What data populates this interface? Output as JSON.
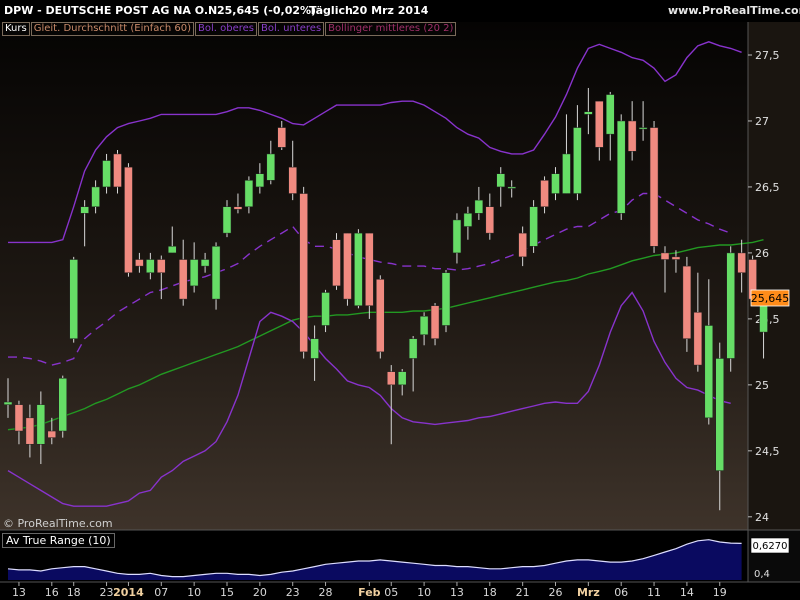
{
  "header": {
    "symbol_line": "DPW - DEUTSCHE POST AG NA O.N.",
    "price_change": "25,645 (-0,02%)",
    "period": "Täglich",
    "date": "20 Mrz 2014",
    "site": "www.ProRealTime.com"
  },
  "legend": {
    "items": [
      {
        "label": "Kurs",
        "color": "#ffffff"
      },
      {
        "label": "Gleit. Durchschnitt (Einfach 60)",
        "color": "#c98a6a"
      },
      {
        "label": "Bol. oberes",
        "color": "#8a3fc8"
      },
      {
        "label": "Bol. unteres",
        "color": "#8a3fc8"
      },
      {
        "label": "Bollinger mittleres (20 2)",
        "color": "#a0306a"
      }
    ]
  },
  "copyright": "© ProRealTime.com",
  "price_label": "25,645",
  "atr": {
    "title": "Av True Range (10)",
    "value_label": "0,6270",
    "tick_label": "0,4",
    "values": [
      0.4,
      0.39,
      0.39,
      0.38,
      0.4,
      0.41,
      0.42,
      0.42,
      0.4,
      0.38,
      0.36,
      0.35,
      0.35,
      0.36,
      0.34,
      0.33,
      0.33,
      0.34,
      0.35,
      0.36,
      0.36,
      0.35,
      0.35,
      0.34,
      0.35,
      0.37,
      0.38,
      0.4,
      0.42,
      0.44,
      0.45,
      0.46,
      0.47,
      0.47,
      0.48,
      0.47,
      0.46,
      0.45,
      0.44,
      0.43,
      0.43,
      0.42,
      0.42,
      0.41,
      0.4,
      0.4,
      0.41,
      0.42,
      0.42,
      0.43,
      0.45,
      0.47,
      0.48,
      0.48,
      0.47,
      0.46,
      0.46,
      0.47,
      0.49,
      0.52,
      0.55,
      0.58,
      0.62,
      0.65,
      0.66,
      0.64,
      0.63,
      0.627
    ],
    "ylim": [
      0.3,
      0.72
    ]
  },
  "colors": {
    "up": "#66dd66",
    "down": "#f08a80",
    "ma60": "#229922",
    "boll_band": "#8833cc",
    "boll_mid": "#8833cc",
    "atr_fill": "#0a0a60",
    "atr_line": "#ddddff"
  },
  "chart_data": {
    "type": "candlestick",
    "ylim": [
      23.9,
      27.75
    ],
    "yticks": [
      24,
      24.5,
      25,
      25.5,
      26,
      26.5,
      27,
      27.5
    ],
    "ytick_labels": [
      "24",
      "24,5",
      "25",
      "25,5",
      "26",
      "26,5",
      "27",
      "27,5"
    ],
    "xtick_labels": [
      {
        "i": 1,
        "label": "13"
      },
      {
        "i": 4,
        "label": "16"
      },
      {
        "i": 6,
        "label": "18"
      },
      {
        "i": 9,
        "label": "23"
      },
      {
        "i": 11,
        "label": "2014"
      },
      {
        "i": 14,
        "label": "07"
      },
      {
        "i": 17,
        "label": "10"
      },
      {
        "i": 20,
        "label": "15"
      },
      {
        "i": 23,
        "label": "20"
      },
      {
        "i": 26,
        "label": "23"
      },
      {
        "i": 29,
        "label": "28"
      },
      {
        "i": 33,
        "label": "Feb"
      },
      {
        "i": 35,
        "label": "05"
      },
      {
        "i": 38,
        "label": "10"
      },
      {
        "i": 41,
        "label": "13"
      },
      {
        "i": 44,
        "label": "18"
      },
      {
        "i": 47,
        "label": "21"
      },
      {
        "i": 50,
        "label": "26"
      },
      {
        "i": 53,
        "label": "Mrz"
      },
      {
        "i": 56,
        "label": "06"
      },
      {
        "i": 59,
        "label": "11"
      },
      {
        "i": 62,
        "label": "14"
      },
      {
        "i": 65,
        "label": "19"
      }
    ],
    "candles": [
      [
        24.85,
        24.87,
        24.75,
        25.05
      ],
      [
        24.85,
        24.65,
        24.55,
        24.88
      ],
      [
        24.75,
        24.55,
        24.45,
        24.85
      ],
      [
        24.55,
        24.85,
        24.4,
        24.95
      ],
      [
        24.65,
        24.6,
        24.55,
        24.75
      ],
      [
        24.65,
        25.05,
        24.6,
        25.07
      ],
      [
        25.35,
        25.95,
        25.32,
        25.97
      ],
      [
        26.3,
        26.35,
        26.05,
        26.4
      ],
      [
        26.35,
        26.5,
        26.3,
        26.55
      ],
      [
        26.5,
        26.7,
        26.45,
        26.75
      ],
      [
        26.75,
        26.5,
        26.45,
        26.78
      ],
      [
        26.65,
        25.85,
        25.82,
        26.68
      ],
      [
        25.95,
        25.9,
        25.85,
        26.0
      ],
      [
        25.85,
        25.95,
        25.8,
        26.0
      ],
      [
        25.95,
        25.85,
        25.65,
        25.98
      ],
      [
        26.0,
        26.05,
        26.0,
        26.2
      ],
      [
        25.95,
        25.65,
        25.6,
        26.1
      ],
      [
        25.75,
        25.95,
        25.7,
        26.08
      ],
      [
        25.9,
        25.95,
        25.85,
        26.0
      ],
      [
        25.65,
        26.05,
        25.57,
        26.08
      ],
      [
        26.15,
        26.35,
        26.12,
        26.4
      ],
      [
        26.35,
        26.33,
        26.3,
        26.45
      ],
      [
        26.35,
        26.55,
        26.3,
        26.58
      ],
      [
        26.5,
        26.6,
        26.45,
        26.68
      ],
      [
        26.55,
        26.75,
        26.52,
        26.85
      ],
      [
        26.95,
        26.8,
        26.78,
        27.0
      ],
      [
        26.65,
        26.45,
        26.4,
        26.85
      ],
      [
        26.45,
        25.25,
        25.2,
        26.5
      ],
      [
        25.2,
        25.35,
        25.03,
        25.45
      ],
      [
        25.45,
        25.7,
        25.4,
        25.72
      ],
      [
        26.1,
        25.75,
        25.72,
        26.15
      ],
      [
        26.15,
        25.65,
        25.6,
        26.15
      ],
      [
        25.6,
        26.15,
        25.58,
        26.18
      ],
      [
        26.15,
        25.6,
        25.5,
        26.15
      ],
      [
        25.8,
        25.25,
        25.2,
        25.83
      ],
      [
        25.1,
        25.0,
        24.55,
        25.15
      ],
      [
        25.0,
        25.1,
        24.92,
        25.12
      ],
      [
        25.2,
        25.35,
        24.95,
        25.37
      ],
      [
        25.38,
        25.52,
        25.3,
        25.55
      ],
      [
        25.6,
        25.35,
        25.3,
        25.62
      ],
      [
        25.45,
        25.85,
        25.4,
        25.87
      ],
      [
        26.0,
        26.25,
        25.92,
        26.3
      ],
      [
        26.2,
        26.3,
        26.1,
        26.35
      ],
      [
        26.3,
        26.4,
        26.25,
        26.5
      ],
      [
        26.35,
        26.15,
        26.1,
        26.45
      ],
      [
        26.5,
        26.6,
        26.35,
        26.65
      ],
      [
        26.5,
        26.5,
        26.42,
        26.55
      ],
      [
        26.15,
        25.97,
        25.9,
        26.2
      ],
      [
        26.05,
        26.35,
        26.0,
        26.4
      ],
      [
        26.55,
        26.35,
        26.3,
        26.58
      ],
      [
        26.45,
        26.6,
        26.4,
        26.65
      ],
      [
        26.45,
        26.75,
        26.45,
        27.05
      ],
      [
        26.45,
        26.95,
        26.4,
        27.12
      ],
      [
        27.05,
        27.07,
        26.9,
        27.25
      ],
      [
        27.15,
        26.8,
        26.7,
        27.15
      ],
      [
        26.9,
        27.2,
        26.7,
        27.22
      ],
      [
        26.3,
        27.0,
        26.25,
        27.05
      ],
      [
        27.0,
        26.77,
        26.7,
        27.15
      ],
      [
        26.95,
        26.95,
        26.85,
        27.15
      ],
      [
        26.95,
        26.05,
        26.0,
        27.0
      ],
      [
        26.0,
        25.95,
        25.7,
        26.05
      ],
      [
        25.97,
        25.95,
        25.85,
        26.02
      ],
      [
        25.9,
        25.35,
        25.25,
        25.97
      ],
      [
        25.55,
        25.15,
        25.1,
        25.85
      ],
      [
        24.75,
        25.45,
        24.7,
        25.8
      ],
      [
        24.35,
        25.2,
        24.05,
        25.32
      ],
      [
        25.2,
        26.0,
        25.1,
        26.05
      ],
      [
        26.0,
        25.85,
        25.7,
        26.1
      ],
      [
        25.95,
        25.65,
        25.6,
        25.98
      ],
      [
        25.4,
        25.65,
        25.2,
        25.7
      ]
    ],
    "ma60": [
      24.66,
      24.67,
      24.68,
      24.7,
      24.73,
      24.76,
      24.79,
      24.82,
      24.86,
      24.89,
      24.93,
      24.97,
      25.0,
      25.04,
      25.08,
      25.11,
      25.14,
      25.17,
      25.2,
      25.23,
      25.26,
      25.29,
      25.33,
      25.37,
      25.41,
      25.45,
      25.49,
      25.51,
      25.52,
      25.52,
      25.53,
      25.53,
      25.54,
      25.55,
      25.55,
      25.55,
      25.55,
      25.56,
      25.56,
      25.57,
      25.58,
      25.6,
      25.62,
      25.64,
      25.66,
      25.68,
      25.7,
      25.72,
      25.74,
      25.76,
      25.78,
      25.79,
      25.81,
      25.84,
      25.86,
      25.88,
      25.91,
      25.94,
      25.96,
      25.98,
      25.99,
      26.0,
      26.02,
      26.04,
      26.05,
      26.06,
      26.06,
      26.07,
      26.08,
      26.1
    ],
    "boll_upper": [
      26.08,
      26.08,
      26.08,
      26.08,
      26.08,
      26.1,
      26.35,
      26.62,
      26.78,
      26.88,
      26.95,
      26.98,
      27.0,
      27.02,
      27.05,
      27.05,
      27.05,
      27.05,
      27.05,
      27.05,
      27.07,
      27.1,
      27.1,
      27.08,
      27.05,
      27.02,
      26.98,
      26.97,
      27.02,
      27.07,
      27.12,
      27.12,
      27.12,
      27.12,
      27.12,
      27.14,
      27.15,
      27.15,
      27.12,
      27.07,
      27.02,
      26.95,
      26.9,
      26.87,
      26.8,
      26.77,
      26.75,
      26.75,
      26.78,
      26.9,
      27.03,
      27.2,
      27.4,
      27.55,
      27.58,
      27.55,
      27.52,
      27.48,
      27.46,
      27.4,
      27.3,
      27.35,
      27.48,
      27.57,
      27.6,
      27.57,
      27.55,
      27.52
    ],
    "boll_lower": [
      24.35,
      24.3,
      24.25,
      24.2,
      24.15,
      24.1,
      24.08,
      24.08,
      24.08,
      24.08,
      24.1,
      24.12,
      24.18,
      24.2,
      24.3,
      24.35,
      24.42,
      24.46,
      24.5,
      24.57,
      24.72,
      24.92,
      25.2,
      25.48,
      25.55,
      25.52,
      25.48,
      25.4,
      25.3,
      25.2,
      25.12,
      25.03,
      25.0,
      24.98,
      24.92,
      24.82,
      24.75,
      24.72,
      24.71,
      24.7,
      24.71,
      24.72,
      24.73,
      24.75,
      24.76,
      24.78,
      24.8,
      24.82,
      24.84,
      24.86,
      24.87,
      24.86,
      24.86,
      24.95,
      25.15,
      25.4,
      25.6,
      25.7,
      25.56,
      25.33,
      25.17,
      25.05,
      24.98,
      24.96,
      24.92,
      24.88,
      24.86
    ],
    "boll_middle": [
      25.21,
      25.21,
      25.2,
      25.18,
      25.15,
      25.17,
      25.2,
      25.35,
      25.42,
      25.48,
      25.55,
      25.6,
      25.65,
      25.7,
      25.72,
      25.75,
      25.78,
      25.8,
      25.82,
      25.85,
      25.88,
      25.92,
      25.99,
      26.05,
      26.1,
      26.15,
      26.2,
      26.1,
      26.05,
      26.05,
      26.03,
      26.0,
      25.97,
      25.95,
      25.93,
      25.92,
      25.9,
      25.9,
      25.9,
      25.88,
      25.88,
      25.87,
      25.88,
      25.9,
      25.92,
      25.95,
      25.98,
      26.02,
      26.06,
      26.1,
      26.14,
      26.18,
      26.2,
      26.2,
      26.25,
      26.3,
      26.32,
      26.4,
      26.45,
      26.45,
      26.4,
      26.35,
      26.3,
      26.25,
      26.22,
      26.18,
      26.15
    ]
  }
}
